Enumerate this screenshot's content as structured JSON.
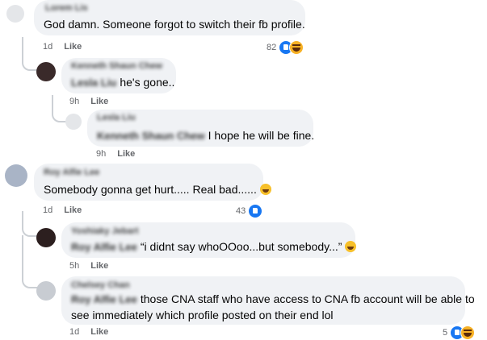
{
  "comments": [
    {
      "text": "God damn. Someone forgot to switch their fb profile.",
      "time": "1d",
      "like": "Like",
      "reactions": "82"
    },
    {
      "text": "he's gone..",
      "time": "9h",
      "like": "Like"
    },
    {
      "text": "I hope he will be fine.",
      "time": "9h",
      "like": "Like"
    },
    {
      "text": "Somebody gonna get hurt..... Real bad......",
      "time": "1d",
      "like": "Like",
      "reactions": "43"
    },
    {
      "text": "“i didnt say whoOOoo...but somebody...”",
      "time": "5h",
      "like": "Like"
    },
    {
      "text_line1": "those CNA staff who have access to CNA fb account will be able to",
      "text_line2": "see immediately which profile posted on their end lol",
      "time": "1d",
      "like": "Like",
      "reactions": "5"
    }
  ],
  "colors": {
    "bubble": "#f0f2f5",
    "meta": "#65676b",
    "like_blue": "#1877f2"
  },
  "icons": [
    "like-icon",
    "haha-icon",
    "grinning-emoji"
  ]
}
